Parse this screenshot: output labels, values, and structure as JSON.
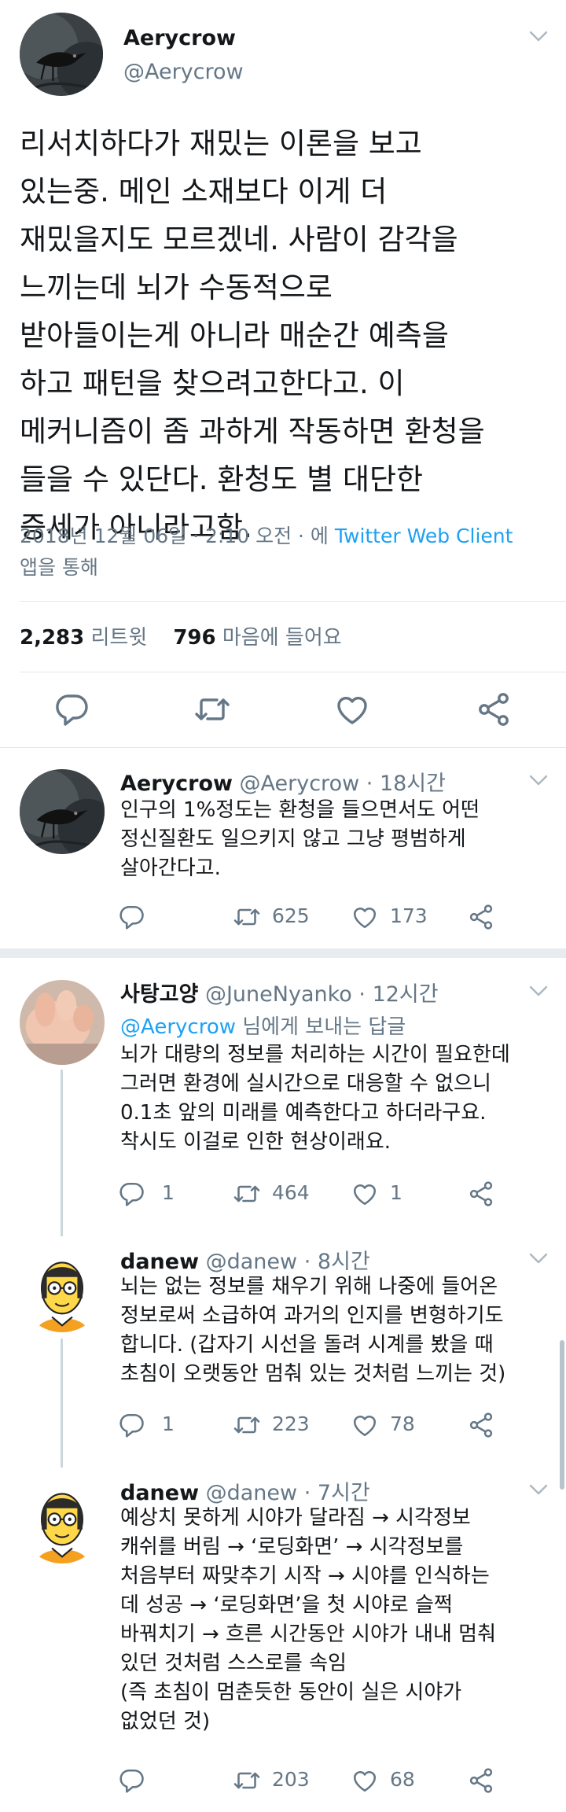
{
  "main_tweet": {
    "name": "Aerycrow",
    "handle": "@Aerycrow",
    "text_lines": [
      "리서치하다가 재밌는 이론을 보고",
      "있는중. 메인 소재보다 이게 더",
      "재밌을지도 모르겠네. 사람이 감각을",
      "느끼는데 뇌가 수동적으로",
      "받아들이는게 아니라 매순간 예측을",
      "하고 패턴을 찾으려고한다고. 이",
      "메커니즘이 좀 과하게 작동하면 환청을",
      "들을 수 있단다. 환청도 별 대단한",
      "증세가 아니라고함."
    ],
    "meta_prefix": "2018년 12월 06일 · 2:10 오전 · 에 ",
    "client": "Twitter Web Client",
    "meta_suffix": "앱을 통해",
    "retweets_count": "2,283",
    "retweets_label": " 리트윗",
    "likes_count": "796",
    "likes_label": " 마음에 들어요"
  },
  "replies": [
    {
      "name": "Aerycrow",
      "handle": "@Aerycrow",
      "time": "18시간",
      "lines": [
        "인구의 1%정도는 환청을 들으면서도 어떤",
        "정신질환도 일으키지 않고 그냥 평범하게",
        "살아간다고."
      ],
      "replies_count": "",
      "retweets_count": "625",
      "likes_count": "173"
    },
    {
      "name": "사탕고양",
      "handle": "@JuneNyanko",
      "time": "12시간",
      "reply_mention": "@Aerycrow",
      "reply_suffix": " 님에게 보내는 답글",
      "lines": [
        "뇌가 대량의 정보를 처리하는 시간이 필요한데",
        "그러면 환경에 실시간으로 대응할 수 없으니",
        "0.1초 앞의 미래를 예측한다고 하더라구요.",
        "착시도 이걸로 인한 현상이래요."
      ],
      "replies_count": "1",
      "retweets_count": "464",
      "likes_count": "1"
    },
    {
      "name": "danew",
      "handle": "@danew",
      "time": "8시간",
      "lines": [
        "뇌는 없는 정보를 채우기 위해 나중에 들어온",
        "정보로써 소급하여 과거의 인지를 변형하기도",
        "합니다. (갑자기 시선을 돌려 시계를 봤을 때",
        "초침이 오랫동안 멈춰 있는 것처럼 느끼는 것)"
      ],
      "replies_count": "1",
      "retweets_count": "223",
      "likes_count": "78"
    },
    {
      "name": "danew",
      "handle": "@danew",
      "time": "7시간",
      "lines": [
        "예상치 못하게 시야가 달라짐 → 시각정보",
        "캐쉬를 버림 → ‘로딩화면’ → 시각정보를",
        "처음부터 짜맞추기 시작 → 시야를 인식하는",
        "데 성공 → ‘로딩화면’을 첫 시야로 슬쩍",
        "바꿔치기 → 흐른 시간동안 시야가 내내 멈춰",
        "있던 것처럼 스스로를 속임",
        "(즉 초침이 멈춘듯한 동안이 실은 시야가",
        "없었던 것)"
      ],
      "replies_count": "",
      "retweets_count": "203",
      "likes_count": "68"
    }
  ],
  "colors": {
    "text": "#14171a",
    "secondary": "#657786",
    "link": "#1da1f2",
    "divider": "#e1e8ed"
  },
  "icons": [
    "chevron-down-icon",
    "reply-icon",
    "retweet-icon",
    "like-icon",
    "share-icon"
  ]
}
